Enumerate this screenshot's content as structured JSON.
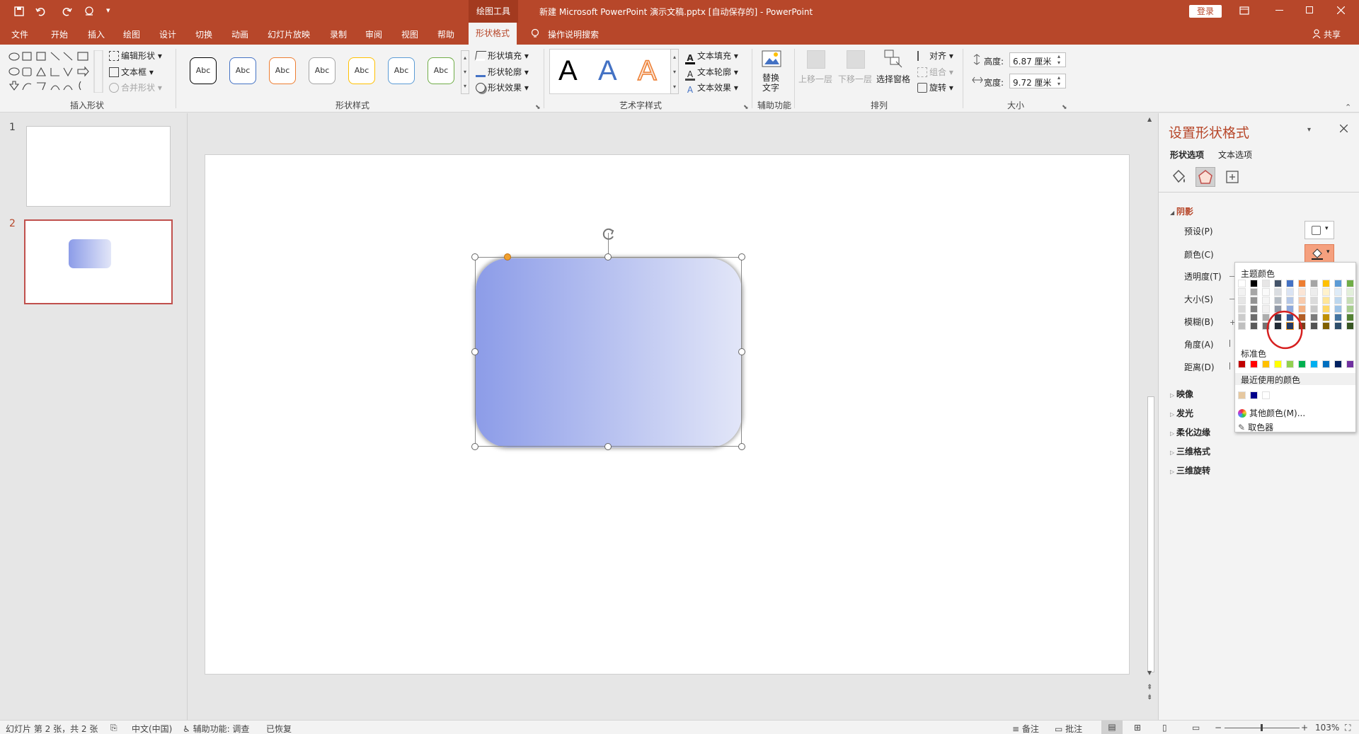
{
  "titlebar": {
    "context_tool": "绘图工具",
    "title": "新建 Microsoft PowerPoint 演示文稿.pptx [自动保存的]  -  PowerPoint",
    "login_button": "登录"
  },
  "tabs": [
    "文件",
    "开始",
    "插入",
    "绘图",
    "设计",
    "切换",
    "动画",
    "幻灯片放映",
    "录制",
    "审阅",
    "视图",
    "帮助"
  ],
  "active_tab": "形状格式",
  "tell_me": "操作说明搜索",
  "share": "共享",
  "ribbon": {
    "insert_shapes": {
      "label": "插入形状",
      "edit_shape": "编辑形状",
      "text_box": "文本框",
      "merge_shapes": "合并形状"
    },
    "shape_styles": {
      "label": "形状样式",
      "preset_text": "Abc",
      "fill": "形状填充",
      "outline": "形状轮廓",
      "effects": "形状效果",
      "style_colors": [
        "#000000",
        "#4472c4",
        "#ed7d31",
        "#a5a5a5",
        "#ffc000",
        "#5b9bd5",
        "#70ad47"
      ]
    },
    "wordart": {
      "label": "艺术字样式",
      "letter": "A",
      "text_fill": "文本填充",
      "text_outline": "文本轮廓",
      "text_effects": "文本效果"
    },
    "accessibility": {
      "label": "辅助功能",
      "alt_text_line1": "替换",
      "alt_text_line2": "文字"
    },
    "arrange": {
      "label": "排列",
      "bring_forward": "上移一层",
      "send_backward": "下移一层",
      "selection_pane": "选择窗格",
      "align": "对齐",
      "group": "组合",
      "rotate": "旋转"
    },
    "size": {
      "label": "大小",
      "height_label": "高度:",
      "height_value": "6.87 厘米",
      "width_label": "宽度:",
      "width_value": "9.72 厘米"
    }
  },
  "slides": [
    {
      "number": "1"
    },
    {
      "number": "2"
    }
  ],
  "shape": {
    "gradient_start": "#8c9ce8",
    "gradient_end": "#e2e6f8"
  },
  "format_pane": {
    "title": "设置形状格式",
    "tab_shape": "形状选项",
    "tab_text": "文本选项",
    "section_shadow": "阴影",
    "rows": {
      "preset": "预设(P)",
      "color": "颜色(C)",
      "transparency": "透明度(T)",
      "size": "大小(S)",
      "blur": "模糊(B)",
      "angle": "角度(A)",
      "distance": "距离(D)"
    },
    "collapsed_sections": [
      "映像",
      "发光",
      "柔化边缘",
      "三维格式",
      "三维旋转"
    ]
  },
  "color_popup": {
    "theme_colors_title": "主题颜色",
    "theme_top": [
      "#ffffff",
      "#000000",
      "#e7e6e6",
      "#44546a",
      "#4472c4",
      "#ed7d31",
      "#a5a5a5",
      "#ffc000",
      "#5b9bd5",
      "#70ad47"
    ],
    "standard_title": "标准色",
    "standard": [
      "#c00000",
      "#ff0000",
      "#ffc000",
      "#ffff00",
      "#92d050",
      "#00b050",
      "#00b0f0",
      "#0070c0",
      "#002060",
      "#7030a0"
    ],
    "recent_title": "最近使用的颜色",
    "recent": [
      "#e6c8a0",
      "#00008b",
      "#ffffff"
    ],
    "more_colors": "其他颜色(M)...",
    "eyedropper": "取色器"
  },
  "statusbar": {
    "slide_info": "幻灯片 第 2 张，共 2 张",
    "language": "中文(中国)",
    "accessibility": "辅助功能: 调查",
    "recovered": "已恢复",
    "notes": "备注",
    "comments": "批注",
    "zoom": "103%"
  }
}
